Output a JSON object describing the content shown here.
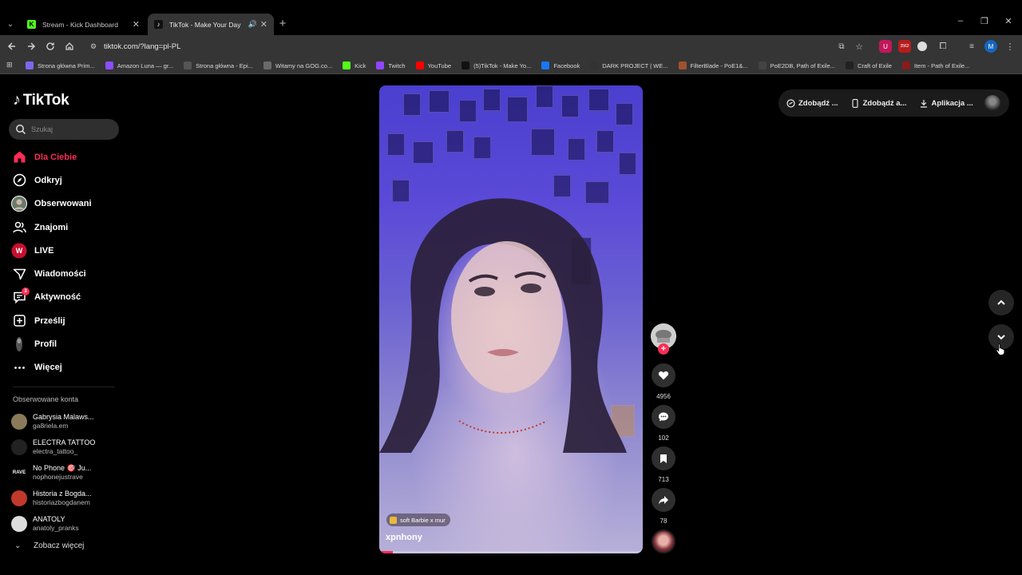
{
  "browser": {
    "tabs": [
      {
        "title": "Stream - Kick Dashboard",
        "favicon": "kick-icon",
        "active": false
      },
      {
        "title": "TikTok - Make Your Day",
        "favicon": "tiktok-icon",
        "active": true
      }
    ],
    "url": "tiktok.com/?lang=pl-PL",
    "profile_initial": "M",
    "extension_badge": "3562",
    "bookmarks": [
      {
        "label": "Strona główna Prim...",
        "icon": "prime-icon",
        "color": "#7b68ee"
      },
      {
        "label": "Amazon Luna — gr...",
        "icon": "luna-icon",
        "color": "#8a4fff"
      },
      {
        "label": "Strona główna - Epi...",
        "icon": "epic-icon",
        "color": "#555555"
      },
      {
        "label": "Witamy na GOG.co...",
        "icon": "gog-icon",
        "color": "#6a6a6a"
      },
      {
        "label": "Kick",
        "icon": "kick-icon",
        "color": "#53fc18"
      },
      {
        "label": "Twitch",
        "icon": "twitch-icon",
        "color": "#9146ff"
      },
      {
        "label": "YouTube",
        "icon": "youtube-icon",
        "color": "#ff0000"
      },
      {
        "label": "(5)TikTok - Make Yo...",
        "icon": "tiktok-icon",
        "color": "#111111"
      },
      {
        "label": "Facebook",
        "icon": "facebook-icon",
        "color": "#1877f2"
      },
      {
        "label": "DARK PROJECT | WE...",
        "icon": "darkproject-icon",
        "color": "#333333"
      },
      {
        "label": "FilterBlade - PoE1&...",
        "icon": "filterblade-icon",
        "color": "#a0522d"
      },
      {
        "label": "PoE2DB, Path of Exile...",
        "icon": "poe2db-icon",
        "color": "#444444"
      },
      {
        "label": "Craft of Exile",
        "icon": "craftofexile-icon",
        "color": "#222222"
      },
      {
        "label": "Item - Path of Exile...",
        "icon": "poewiki-icon",
        "color": "#8b1a1a"
      }
    ]
  },
  "tiktok": {
    "logo": "TikTok",
    "search_placeholder": "Szukaj",
    "nav": [
      {
        "label": "Dla Ciebie",
        "icon": "home-icon",
        "active": true
      },
      {
        "label": "Odkryj",
        "icon": "compass-icon",
        "active": false
      },
      {
        "label": "Obserwowani",
        "icon": "following-avatar-icon",
        "active": false
      },
      {
        "label": "Znajomi",
        "icon": "friends-icon",
        "active": false
      },
      {
        "label": "LIVE",
        "icon": "live-icon",
        "active": false
      },
      {
        "label": "Wiadomości",
        "icon": "send-icon",
        "active": false
      },
      {
        "label": "Aktywność",
        "icon": "activity-icon",
        "active": false,
        "badge": "3"
      },
      {
        "label": "Prześlij",
        "icon": "upload-icon",
        "active": false
      },
      {
        "label": "Profil",
        "icon": "profile-avatar-icon",
        "active": false
      },
      {
        "label": "Więcej",
        "icon": "more-icon",
        "active": false
      }
    ],
    "following_title": "Obserwowane konta",
    "following": [
      {
        "name": "Gabrysia Malaws...",
        "username": "ga8riela.em",
        "avatar_color": "#8a7a5a"
      },
      {
        "name": "ELECTRA TATTOO",
        "username": "electra_tattoo_",
        "avatar_color": "#222222"
      },
      {
        "name": "No Phone 🎯 Ju...",
        "username": "nophonejustrave",
        "avatar_color": "#000000",
        "avatar_text": "RAVE"
      },
      {
        "name": "Historia z Bogda...",
        "username": "historiazbogdanem",
        "avatar_color": "#c0392b"
      },
      {
        "name": "ANATOLY",
        "username": "anatoly_pranks",
        "avatar_color": "#dddddd"
      }
    ],
    "see_more": "Zobacz więcej",
    "video": {
      "author": "xpnhony",
      "sound": "soft Barbie x mur",
      "progress": 0.05,
      "likes": "4956",
      "comments": "102",
      "saves": "713",
      "shares": "78"
    },
    "top_buttons": [
      {
        "label": "Zdobądź ...",
        "icon": "coin-icon"
      },
      {
        "label": "Zdobądź a...",
        "icon": "phone-icon"
      },
      {
        "label": "Aplikacja ...",
        "icon": "download-icon"
      }
    ],
    "accent": "#fe2c55"
  }
}
